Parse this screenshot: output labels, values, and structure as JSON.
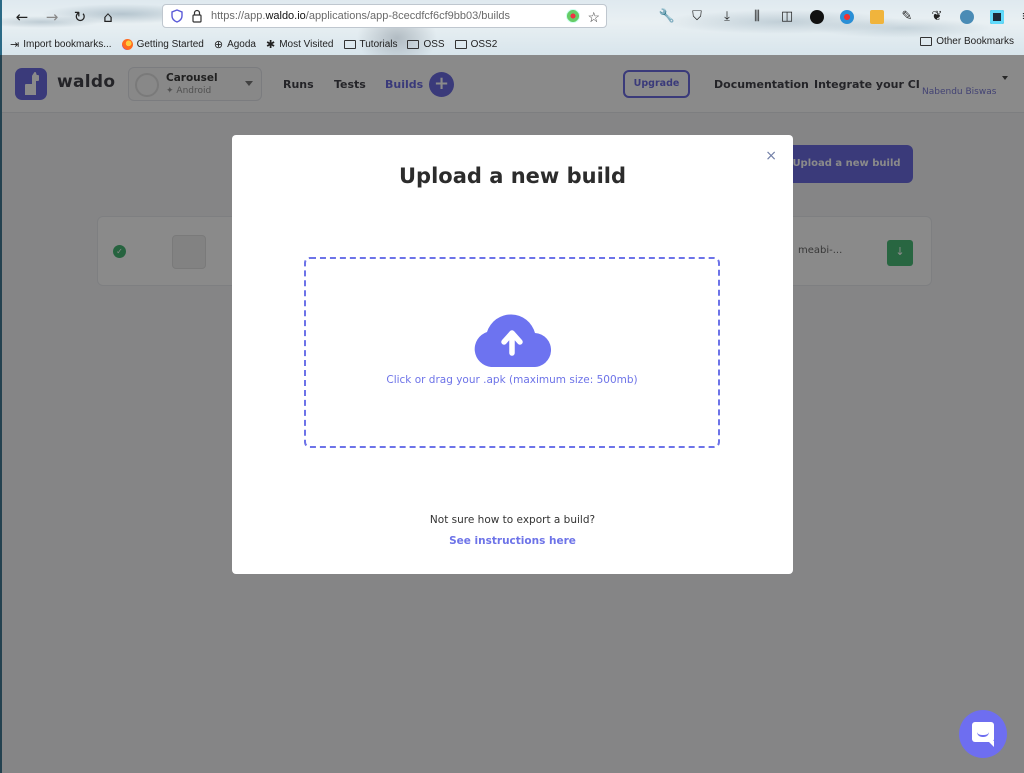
{
  "browser": {
    "url_prefix": "https://app.",
    "url_domain": "waldo.io",
    "url_path": "/applications/app-8cecdfcf6cf9bb03/builds",
    "nav": {
      "back": "←",
      "forward": "→",
      "reload": "↻",
      "home": "⌂"
    },
    "toolbar_icons": [
      "wrench-icon",
      "pocket-icon",
      "download-icon",
      "library-icon",
      "sidebar-icon",
      "extension-twd-icon",
      "extension-globe-icon",
      "extension-slides-icon",
      "extension-notes-icon",
      "extension-foot-icon",
      "extension-bulb-icon",
      "extension-react-icon",
      "menu-icon"
    ],
    "bookmarks": [
      {
        "label": "Import bookmarks...",
        "icon": "import-icon"
      },
      {
        "label": "Getting Started",
        "icon": "firefox-icon"
      },
      {
        "label": "Agoda",
        "icon": "globe-icon"
      },
      {
        "label": "Most Visited",
        "icon": "gear-icon"
      },
      {
        "label": "Tutorials",
        "icon": "folder-icon"
      },
      {
        "label": "OSS",
        "icon": "folder-icon"
      },
      {
        "label": "OSS2",
        "icon": "folder-icon"
      }
    ],
    "other_bookmarks": "Other Bookmarks"
  },
  "app": {
    "brand": "waldo",
    "app_selector": {
      "name": "Carousel",
      "platform": "Android"
    },
    "nav": [
      {
        "label": "Runs",
        "active": false
      },
      {
        "label": "Tests",
        "active": false
      },
      {
        "label": "Builds",
        "active": true
      }
    ],
    "add_label": "+",
    "upgrade_label": "Upgrade",
    "documentation_label": "Documentation",
    "integrate_label": "Integrate your CI",
    "user_subtitle": "Nabendu Biswas",
    "upload_button_label": "Upload a new build",
    "build_row": {
      "status": "success",
      "file": "meabi-...",
      "download_label": "↓"
    }
  },
  "modal": {
    "title": "Upload a new build",
    "close_label": "×",
    "dropzone_text": "Click or drag your .apk (maximum size: 500mb)",
    "help_text": "Not sure how to export a build?",
    "help_link": "See instructions here"
  },
  "colors": {
    "brand": "#5858dd",
    "dropzone": "#6d73e8",
    "success": "#2fae62"
  }
}
